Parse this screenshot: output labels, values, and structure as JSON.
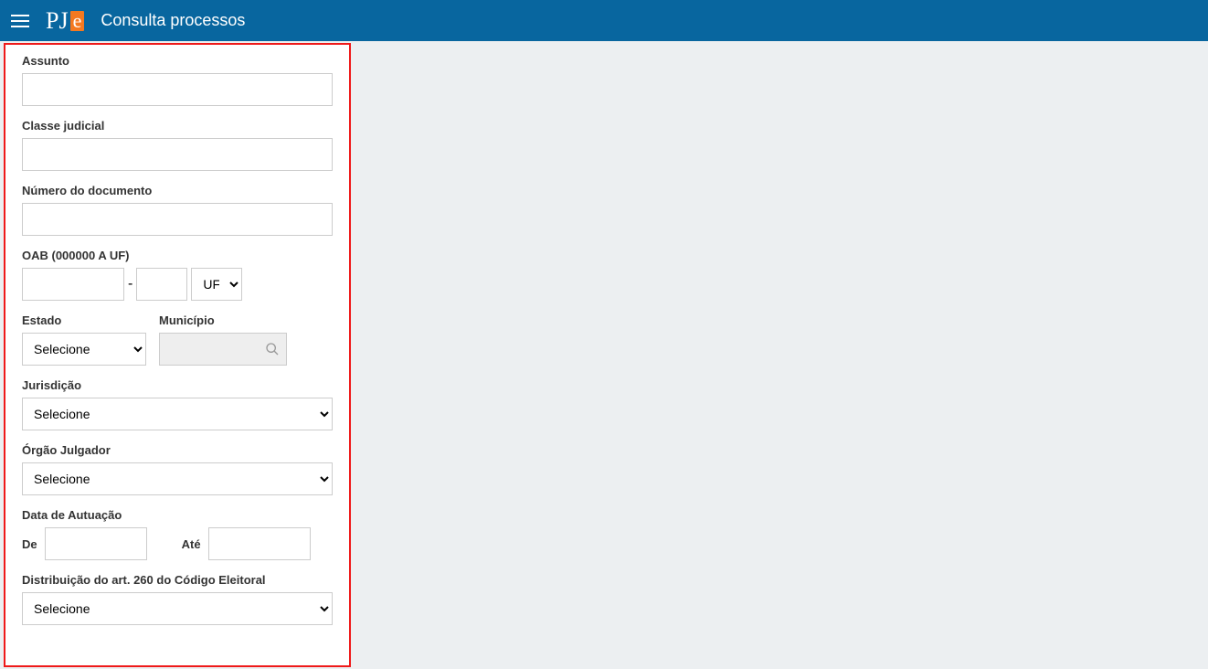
{
  "header": {
    "page_title": "Consulta processos",
    "logo_text_p": "PJ",
    "logo_text_e": "e"
  },
  "form": {
    "assunto": {
      "label": "Assunto",
      "value": ""
    },
    "classe_judicial": {
      "label": "Classe judicial",
      "value": ""
    },
    "numero_documento": {
      "label": "Número do documento",
      "value": ""
    },
    "oab": {
      "label": "OAB (000000 A UF)",
      "numero": "",
      "letra": "",
      "uf_placeholder": "UF"
    },
    "estado": {
      "label": "Estado",
      "selected": "Selecione"
    },
    "municipio": {
      "label": "Município",
      "value": ""
    },
    "jurisdicao": {
      "label": "Jurisdição",
      "selected": "Selecione"
    },
    "orgao_julgador": {
      "label": "Órgão Julgador",
      "selected": "Selecione"
    },
    "data_autuacao": {
      "label": "Data de Autuação",
      "de_label": "De",
      "ate_label": "Até",
      "de": "",
      "ate": ""
    },
    "distribuicao260": {
      "label": "Distribuição do art. 260 do Código Eleitoral",
      "selected": "Selecione"
    }
  }
}
